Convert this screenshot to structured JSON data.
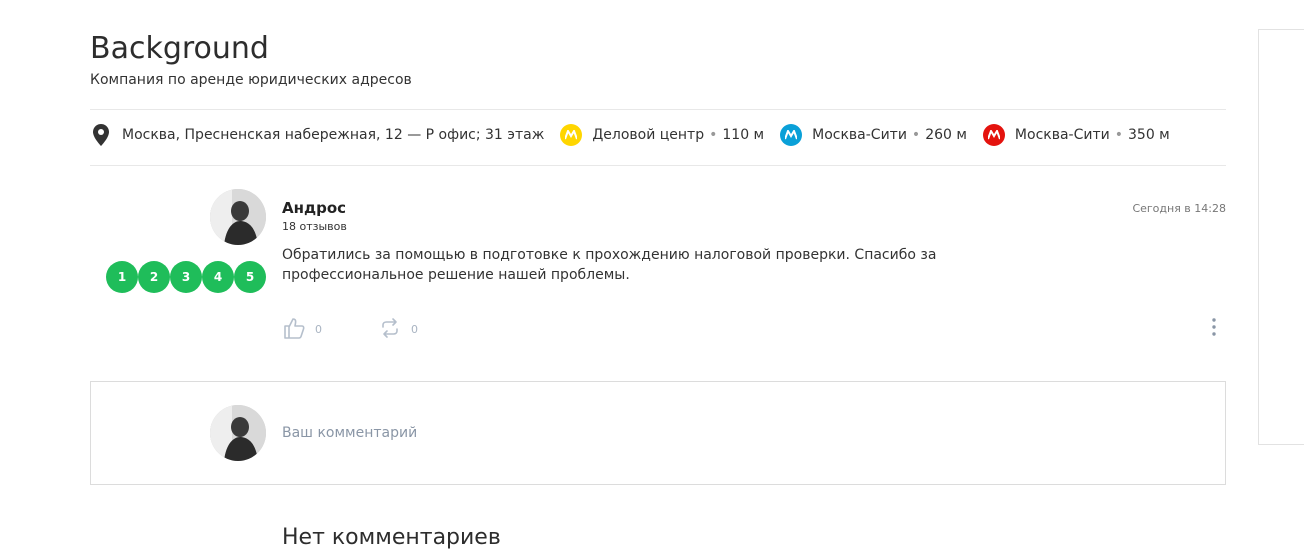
{
  "company": {
    "name": "Background",
    "subtitle": "Компания по аренде юридических адресов"
  },
  "address": {
    "icon": "map-pin-icon",
    "text": "Москва, Пресненская набережная, 12 — Р офис; 31 этаж",
    "metro": [
      {
        "name": "Деловой центр",
        "distance": "110 м",
        "color": "#ffd600",
        "icon": "metro-icon"
      },
      {
        "name": "Москва-Сити",
        "distance": "260 м",
        "color": "#0aa0d8",
        "icon": "metro-icon"
      },
      {
        "name": "Москва-Сити",
        "distance": "350 м",
        "color": "#e4130e",
        "icon": "metro-icon"
      }
    ],
    "separator": "•"
  },
  "review": {
    "author": "Андрос",
    "reviews_count": "18 отзывов",
    "date": "Сегодня в 14:28",
    "text": "Обратились за помощью в подготовке к прохождению налоговой проверки. Спасибо за профессиональное решение нашей проблемы.",
    "rating_labels": [
      "1",
      "2",
      "3",
      "4",
      "5"
    ],
    "rating_color": "#1fbd5a",
    "likes": "0",
    "reposts": "0"
  },
  "comment": {
    "placeholder": "Ваш комментарий"
  },
  "comments_empty": "Нет комментариев"
}
